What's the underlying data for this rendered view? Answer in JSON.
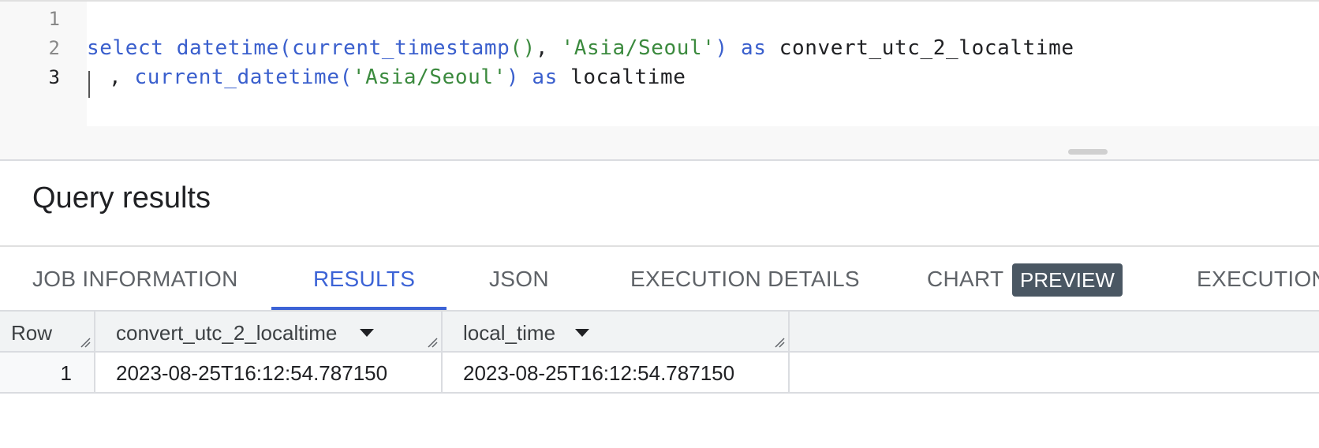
{
  "editor": {
    "line_numbers": [
      "1",
      "2",
      "3"
    ],
    "line2": {
      "t1": "select",
      "t2": " ",
      "t3": "datetime",
      "t4": "(",
      "t5": "current_timestamp",
      "t6": "()",
      "t7": ", ",
      "t8": "'Asia/Seoul'",
      "t9": ")",
      "t10": " as ",
      "t11": "convert_utc_2_localtime"
    },
    "line3": {
      "t1": ", ",
      "t2": "current_datetime",
      "t3": "(",
      "t4": "'Asia/Seoul'",
      "t5": ")",
      "t6": " as ",
      "t7": "localtime"
    }
  },
  "results": {
    "title": "Query results",
    "tabs": {
      "job_information": "JOB INFORMATION",
      "results": "RESULTS",
      "json": "JSON",
      "execution_details": "EXECUTION DETAILS",
      "chart": "CHART",
      "chart_badge": "PREVIEW",
      "execution_graph": "EXECUTION"
    },
    "table": {
      "columns": [
        "Row",
        "convert_utc_2_localtime",
        "local_time"
      ],
      "rows": [
        {
          "row": "1",
          "convert_utc_2_localtime": "2023-08-25T16:12:54.787150",
          "local_time": "2023-08-25T16:12:54.787150"
        }
      ]
    }
  },
  "colors": {
    "keyword": "#3a5fcd",
    "string": "#3b8a3e",
    "active_tab": "#3c63d6",
    "badge_bg": "#4a5763"
  }
}
